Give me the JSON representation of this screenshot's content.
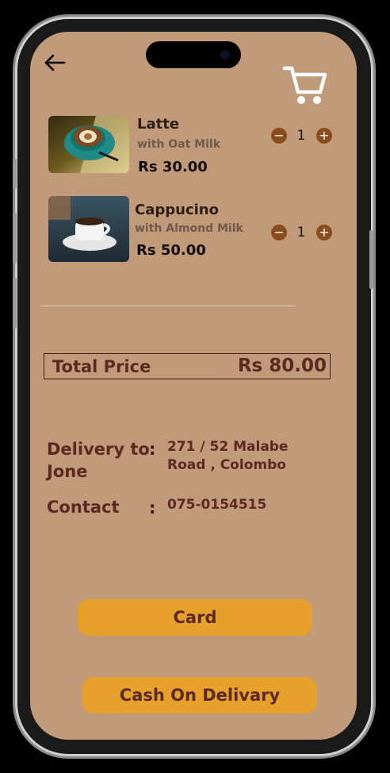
{
  "colors": {
    "screen_background": "#c19a79",
    "accent_button": "#e7a02b",
    "text_brown": "#5a2a22",
    "quantity_button": "#8a4b1d"
  },
  "header": {
    "back_icon": "arrow-left-icon",
    "cart_icon": "shopping-cart-icon"
  },
  "items": [
    {
      "name": "Latte",
      "option": "with Oat Milk",
      "price": "Rs 30.00",
      "quantity": "1",
      "minus": "−",
      "plus": "+",
      "image": "latte-art-cup-photo"
    },
    {
      "name": "Cappucino",
      "option": "with Almond Milk",
      "price": "Rs 50.00",
      "quantity": "1",
      "minus": "−",
      "plus": "+",
      "image": "coffee-cup-photo"
    }
  ],
  "total": {
    "label": "Total Price",
    "value": "Rs 80.00"
  },
  "delivery": {
    "label_line1": "Delivery to",
    "label_line2": "Jone",
    "colon": ":",
    "address_line1": "271 / 52 Malabe",
    "address_line2": "Road , Colombo"
  },
  "contact": {
    "label": "Contact",
    "colon": ":",
    "value": "075-0154515"
  },
  "payment": {
    "card_label": "Card",
    "cod_label": "Cash On Delivary"
  }
}
